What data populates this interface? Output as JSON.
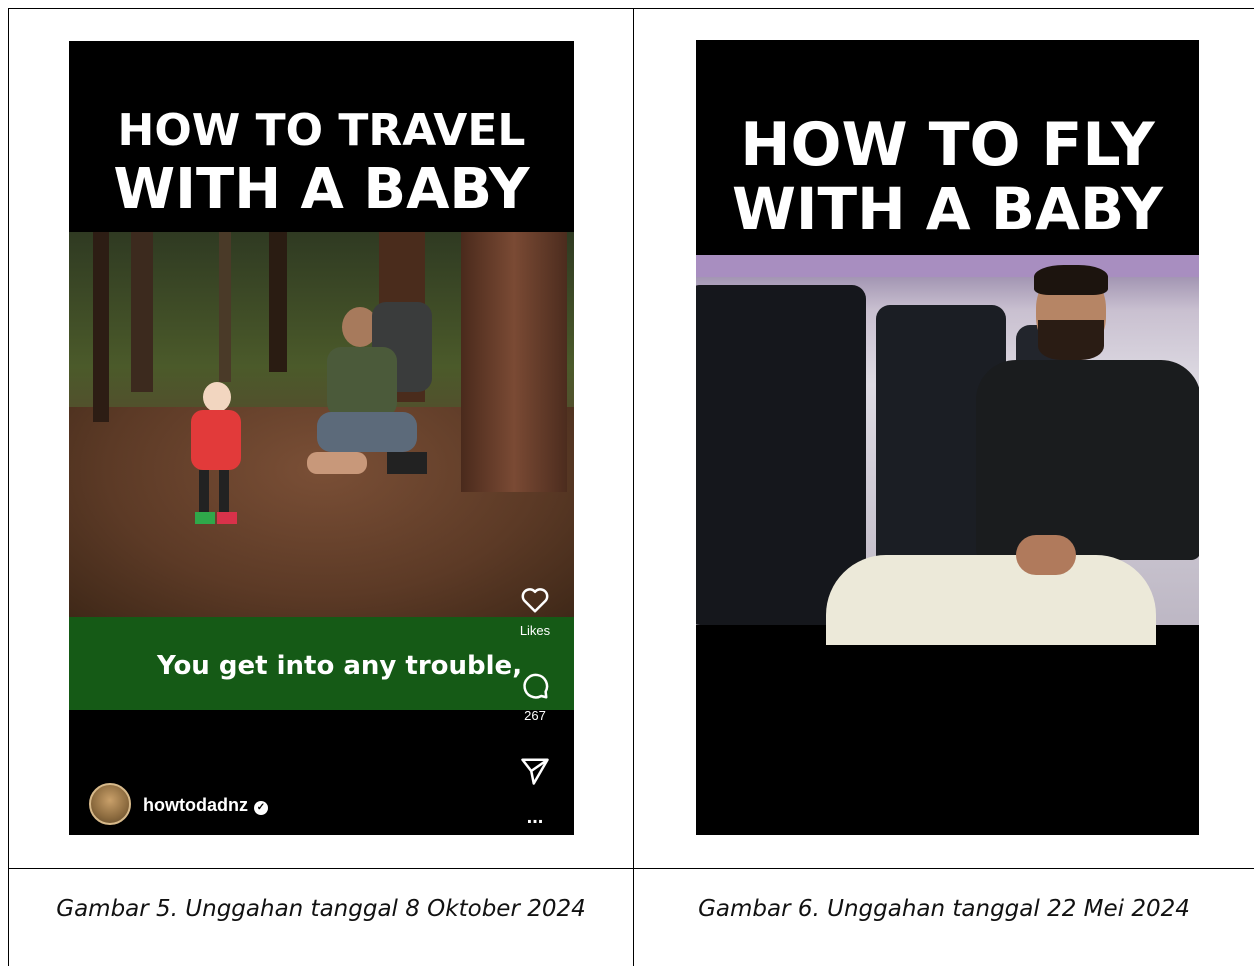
{
  "left_post": {
    "title_line1": "HOW TO TRAVEL",
    "title_line2": "WITH A BABY",
    "subtitle_caption": "You get into any trouble,",
    "likes_label": "Likes",
    "comments_count": "267",
    "username": "howtodadnz",
    "more_label": "..."
  },
  "right_post": {
    "title_line1": "HOW TO FLY",
    "title_line2": "WITH A BABY"
  },
  "captions": {
    "left": "Gambar 5. Unggahan tanggal 8 Oktober 2024",
    "right": "Gambar 6. Unggahan tanggal 22 Mei 2024"
  }
}
